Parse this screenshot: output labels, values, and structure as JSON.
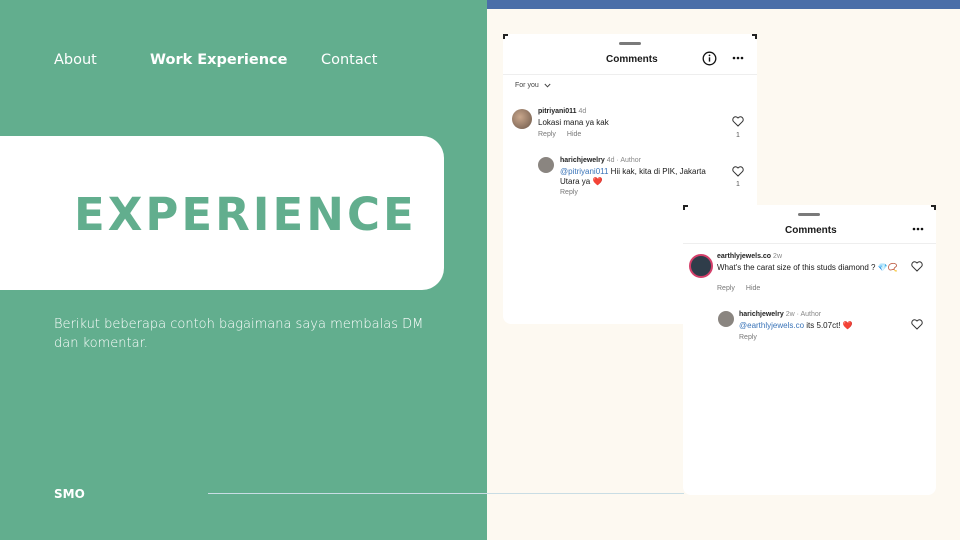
{
  "nav": {
    "about": "About",
    "work": "Work Experience",
    "contact": "Contact"
  },
  "hero": {
    "title": "EXPERIENCE"
  },
  "description": "Berikut beberapa contoh bagaimana saya membalas DM dan komentar.",
  "footer": {
    "label": "SMO"
  },
  "colors": {
    "green": "#62ae8e",
    "cream": "#fdf9f1",
    "blue_bar": "#4a6ea8",
    "mention": "#3a74b8"
  },
  "card1": {
    "title": "Comments",
    "filter": "For you",
    "comment": {
      "user": "pitriyani011",
      "time": "4d",
      "text": "Lokasi mana ya kak",
      "reply": "Reply",
      "hide": "Hide",
      "likes": "1"
    },
    "reply": {
      "user": "harichjewelry",
      "meta": "4d · Author",
      "mention": "@pitriyani011",
      "text": " Hii kak, kita di PIK, Jakarta Utara ya ❤️",
      "reply": "Reply",
      "likes": "1"
    }
  },
  "card2": {
    "title": "Comments",
    "comment": {
      "user": "earthlyjewels.co",
      "time": "2w",
      "text": "What's the carat size of this studs diamond ? 💎📿",
      "reply": "Reply",
      "hide": "Hide"
    },
    "reply": {
      "user": "harichjewelry",
      "meta": "2w · Author",
      "mention": "@earthlyjewels.co",
      "text": " its 5.07ct! ❤️",
      "reply": "Reply"
    }
  },
  "icons": [
    "info-icon",
    "more-icon",
    "chevron-down-icon",
    "heart-icon"
  ]
}
